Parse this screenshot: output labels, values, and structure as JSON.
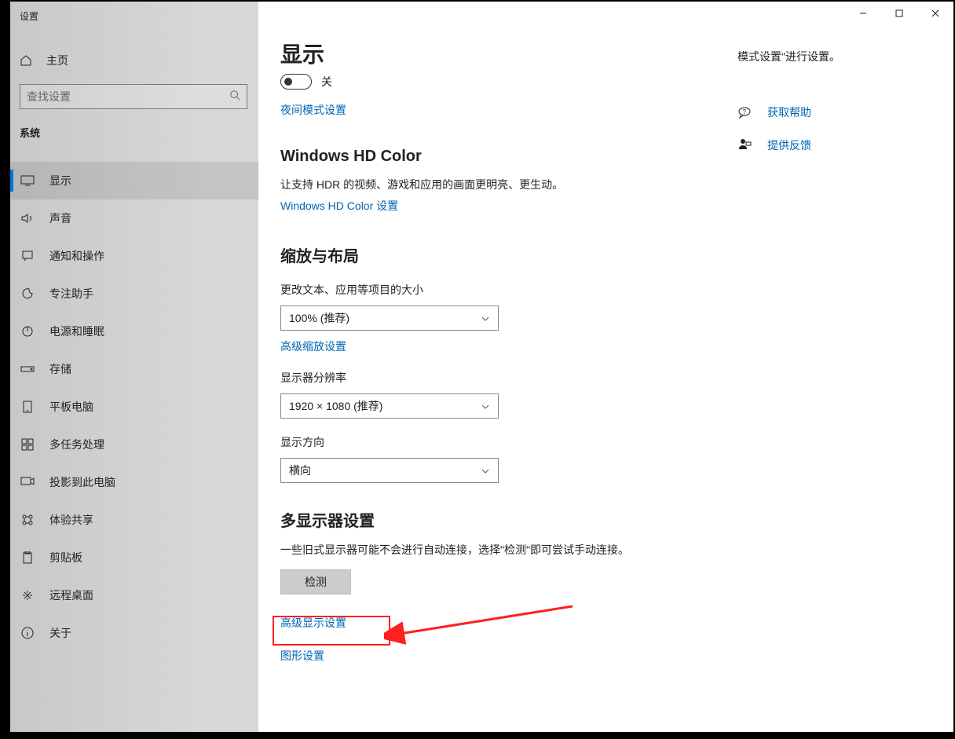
{
  "window": {
    "title": "设置"
  },
  "sidebar": {
    "home": "主页",
    "search_placeholder": "查找设置",
    "category": "系统",
    "items": [
      {
        "label": "显示"
      },
      {
        "label": "声音"
      },
      {
        "label": "通知和操作"
      },
      {
        "label": "专注助手"
      },
      {
        "label": "电源和睡眠"
      },
      {
        "label": "存储"
      },
      {
        "label": "平板电脑"
      },
      {
        "label": "多任务处理"
      },
      {
        "label": "投影到此电脑"
      },
      {
        "label": "体验共享"
      },
      {
        "label": "剪贴板"
      },
      {
        "label": "远程桌面"
      },
      {
        "label": "关于"
      }
    ]
  },
  "main": {
    "page_title": "显示",
    "night_light": {
      "toggle_state": "关",
      "settings_link": "夜间模式设置"
    },
    "hd_color": {
      "title": "Windows HD Color",
      "desc": "让支持 HDR 的视频、游戏和应用的画面更明亮、更生动。",
      "link": "Windows HD Color 设置"
    },
    "scale": {
      "title": "缩放与布局",
      "scale_label": "更改文本、应用等项目的大小",
      "scale_value": "100% (推荐)",
      "advanced_link": "高级缩放设置",
      "resolution_label": "显示器分辨率",
      "resolution_value": "1920 × 1080 (推荐)",
      "orientation_label": "显示方向",
      "orientation_value": "横向"
    },
    "multi": {
      "title": "多显示器设置",
      "desc": "一些旧式显示器可能不会进行自动连接，选择\"检测\"即可尝试手动连接。",
      "detect_btn": "检测",
      "advanced_link": "高级显示设置",
      "graphics_link": "图形设置"
    }
  },
  "right": {
    "top_text_fragment": "模式设置\"进行设置。",
    "help_link": "获取帮助",
    "feedback_link": "提供反馈"
  }
}
